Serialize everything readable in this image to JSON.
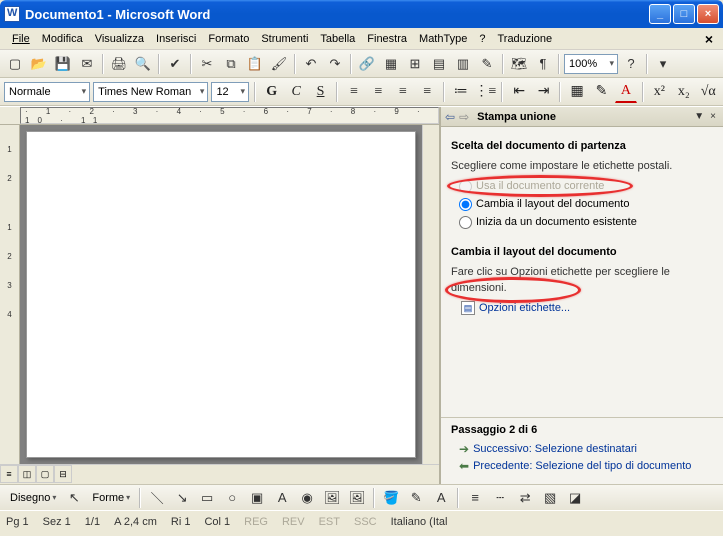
{
  "window": {
    "title": "Documento1 - Microsoft Word"
  },
  "menu": {
    "file": "File",
    "edit": "Modifica",
    "view": "Visualizza",
    "insert": "Inserisci",
    "format": "Formato",
    "tools": "Strumenti",
    "table": "Tabella",
    "window": "Finestra",
    "mathtype": "MathType",
    "help": "?",
    "translate": "Traduzione"
  },
  "toolbar": {
    "zoom": "100%"
  },
  "format": {
    "style": "Normale",
    "font": "Times New Roman",
    "size": "12"
  },
  "ruler": {
    "h": "· 1 · 2 · 3 · 4 · 5 · 6 · 7 · 8 · 9 · 10 · 11",
    "v": [
      "1",
      "2",
      "",
      "1",
      "2",
      "3",
      "4"
    ]
  },
  "taskpane": {
    "title": "Stampa unione",
    "section1_title": "Scelta del documento di partenza",
    "section1_text": "Scegliere come impostare le etichette postali.",
    "opt_use_current": "Usa il documento corrente",
    "opt_change_layout": "Cambia il layout del documento",
    "opt_from_existing": "Inizia da un documento esistente",
    "section2_title": "Cambia il layout del documento",
    "section2_text": "Fare clic su Opzioni etichette per scegliere le dimensioni.",
    "label_options_link": "Opzioni etichette...",
    "step_label": "Passaggio 2 di 6",
    "next_link": "Successivo: Selezione destinatari",
    "prev_link": "Precedente: Selezione del tipo di documento"
  },
  "draw": {
    "label": "Disegno",
    "forms": "Forme"
  },
  "status": {
    "pg": "Pg 1",
    "sez": "Sez 1",
    "pages": "1/1",
    "at": "A 2,4 cm",
    "ri": "Ri 1",
    "col": "Col 1",
    "reg": "REG",
    "rev": "REV",
    "est": "EST",
    "ssc": "SSC",
    "lang": "Italiano (Ital"
  }
}
